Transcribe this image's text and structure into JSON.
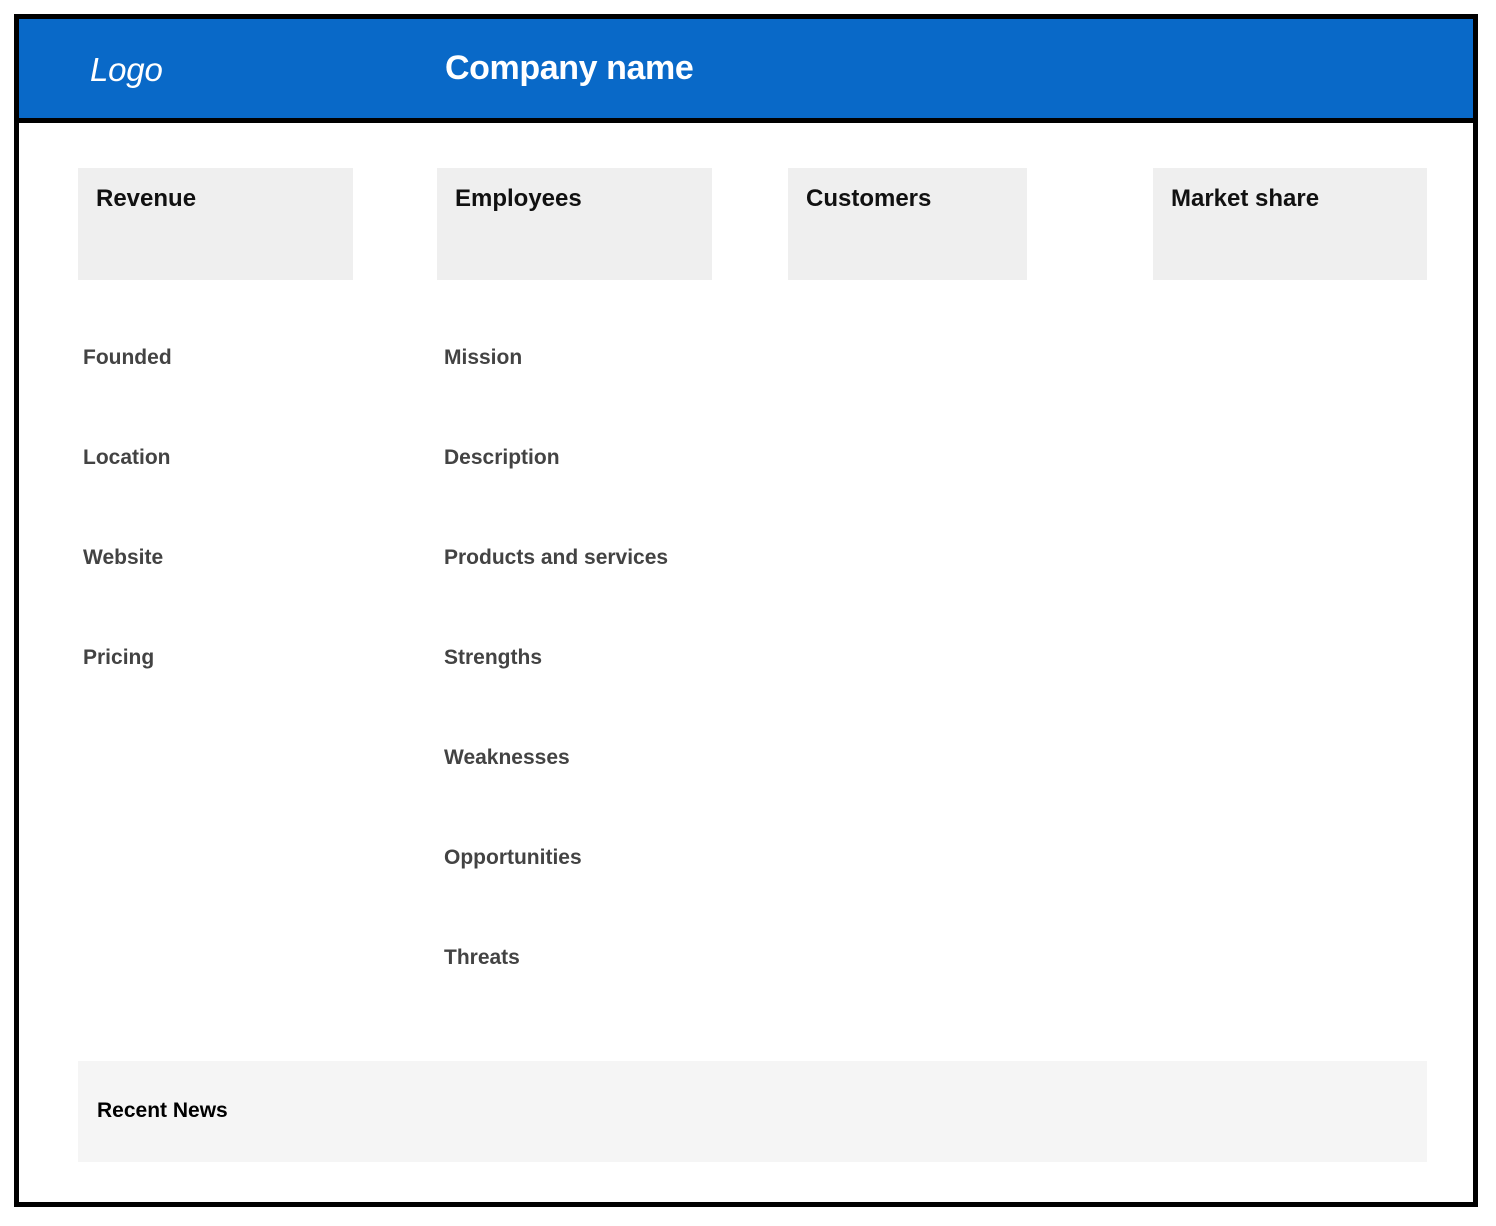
{
  "header": {
    "logo_text": "Logo",
    "company_name": "Company name",
    "background_color": "#0969c8",
    "text_color": "#ffffff"
  },
  "stat_cards": [
    {
      "label": "Revenue"
    },
    {
      "label": "Employees"
    },
    {
      "label": "Customers"
    },
    {
      "label": "Market share"
    }
  ],
  "columns": {
    "left": {
      "fields": [
        {
          "label": "Founded"
        },
        {
          "label": "Location"
        },
        {
          "label": "Website"
        },
        {
          "label": "Pricing"
        }
      ]
    },
    "middle": {
      "fields": [
        {
          "label": "Mission"
        },
        {
          "label": "Description"
        },
        {
          "label": "Products and services"
        },
        {
          "label": "Strengths"
        },
        {
          "label": "Weaknesses"
        },
        {
          "label": "Opportunities"
        },
        {
          "label": "Threats"
        }
      ]
    }
  },
  "news": {
    "title": "Recent News"
  },
  "colors": {
    "accent": "#0969c8",
    "card_background": "#efefef",
    "news_background": "#f5f5f5",
    "label_text": "#434343",
    "border": "#000000",
    "page_background": "#ffffff"
  }
}
